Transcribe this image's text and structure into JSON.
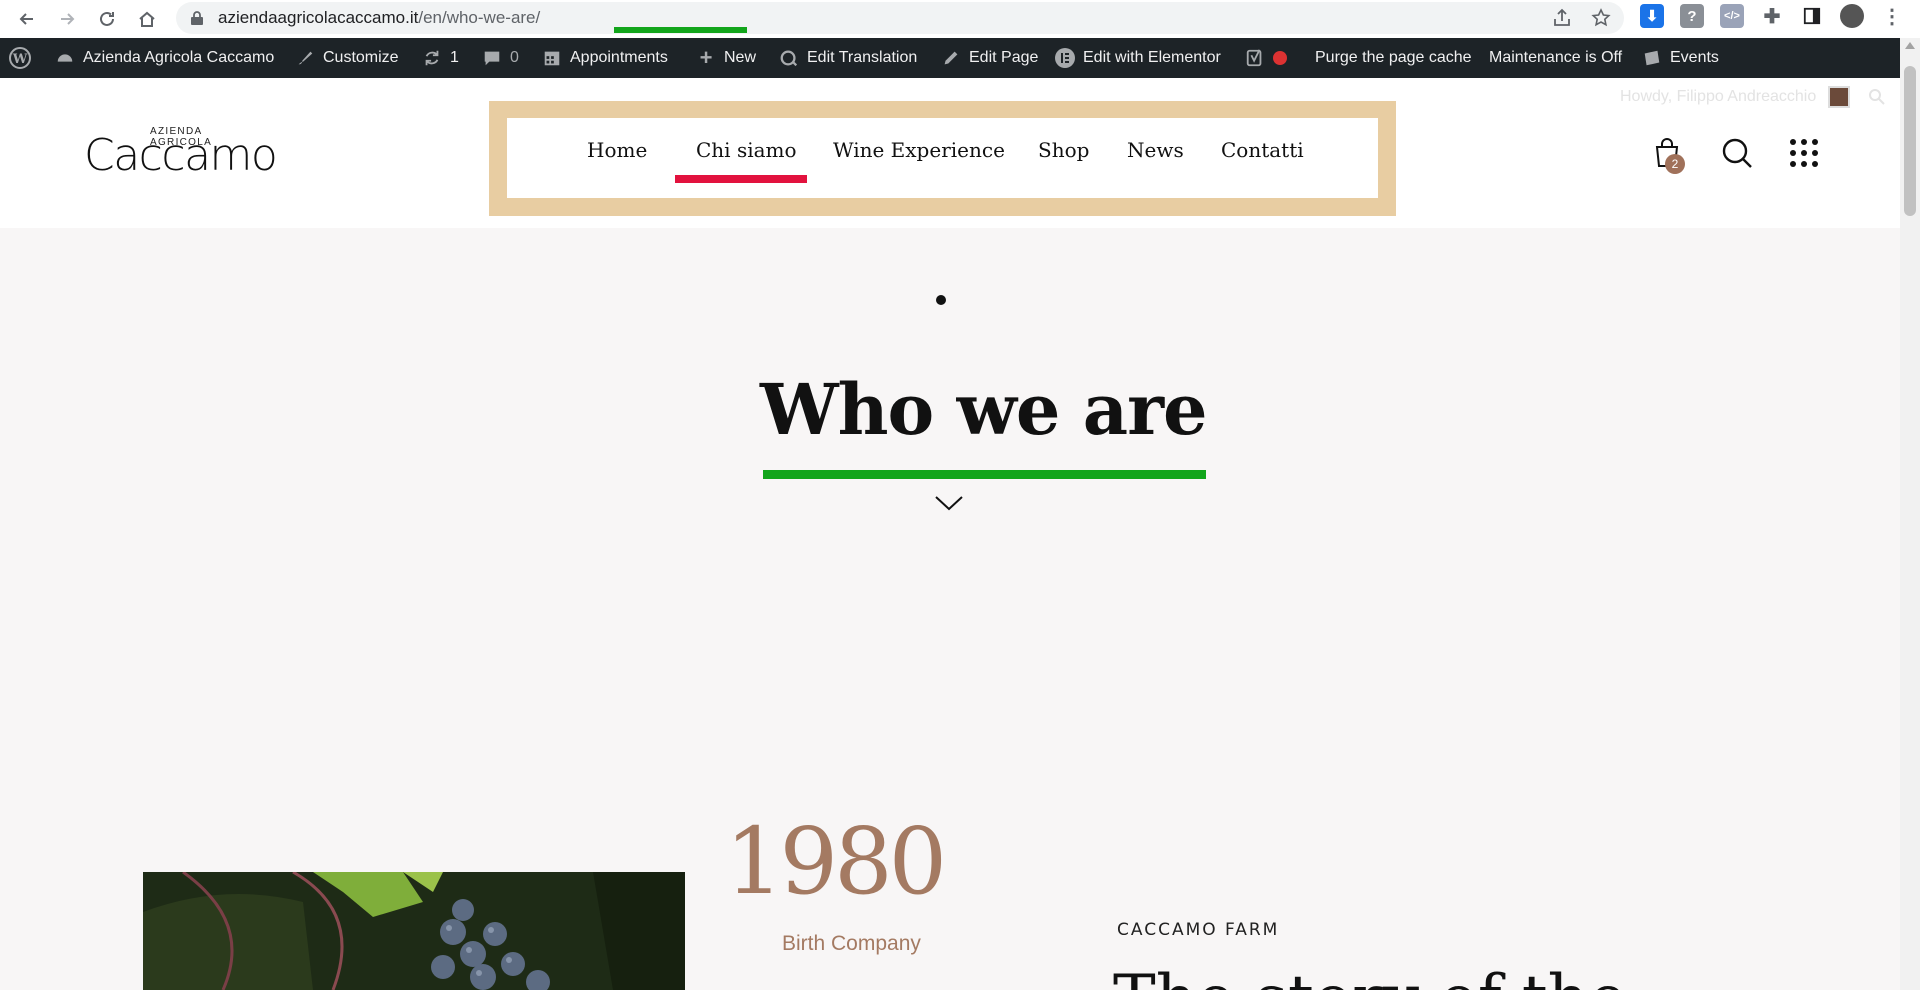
{
  "browser": {
    "url_host": "aziendaagricolacaccamo.it",
    "url_path": "/en/who-we-are/",
    "icons": [
      "back-icon",
      "forward-icon",
      "reload-icon",
      "home-icon",
      "lock-icon",
      "share-icon",
      "star-icon",
      "download-icon",
      "help-icon",
      "code-icon",
      "puzzle-icon",
      "sidebar-icon",
      "profile-icon",
      "kebab-icon"
    ]
  },
  "adminbar": {
    "site_name": "Azienda Agricola Caccamo",
    "customize": "Customize",
    "updates_count": "1",
    "comments_count": "0",
    "appointments": "Appointments",
    "new": "New",
    "edit_translation": "Edit Translation",
    "edit_page": "Edit Page",
    "edit_elementor": "Edit with Elementor",
    "purge_cache": "Purge the page cache",
    "maintenance": "Maintenance is Off",
    "events": "Events",
    "howdy": "Howdy, Filippo Andreacchio"
  },
  "header": {
    "logo_small": "AZIENDA AGRICOLA",
    "logo_main": "Caccamo",
    "nav": [
      "Home",
      "Chi siamo",
      "Wine Experience",
      "Shop",
      "News",
      "Contatti"
    ],
    "active_nav": "Chi siamo",
    "cart_count": "2"
  },
  "hero": {
    "title": "Who we are"
  },
  "content": {
    "year": "1980",
    "year_caption": "Birth Company",
    "eyebrow": "CACCAMO FARM",
    "heading_partial": "The story of the"
  },
  "colors": {
    "annotation_green": "#12a51b",
    "annotation_red": "#e2123e",
    "nav_frame": "#e8cda2",
    "accent_brown": "#a47a62",
    "adminbar_bg": "#1d2327"
  }
}
